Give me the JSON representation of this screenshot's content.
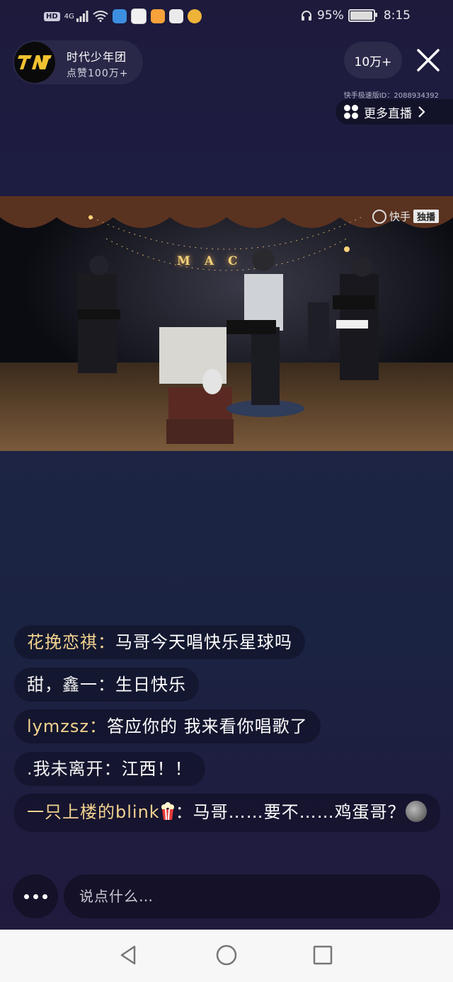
{
  "status_bar": {
    "left_chips": [
      "HD",
      "4G"
    ],
    "battery": "95%",
    "time": "8:15"
  },
  "host": {
    "name": "时代少年团",
    "likes": "点赞100万+"
  },
  "viewers": "10万+",
  "stream_id": "快手极速版ID：2088934392",
  "more_live_label": "更多直播",
  "video": {
    "badge_app": "快手",
    "badge_exclusive": "独播",
    "stage_letters": "MAC"
  },
  "comments": [
    {
      "user": "花挽恋祺：",
      "text": "马哥今天唱快乐星球吗",
      "user_color": "#f3d28f"
    },
    {
      "user": "甜，鑫一：",
      "text": "生日快乐",
      "user_color": "#f1f1f1"
    },
    {
      "user": "lymzsz：",
      "text": "答应你的 我来看你唱歌了",
      "user_color": "#f3d28f"
    },
    {
      "user": ".我未离开：",
      "text": "江西！！",
      "user_color": "#f1f1f1"
    },
    {
      "user": "一只上楼的blink",
      "text": "：马哥……要不……鸡蛋哥？",
      "user_color": "#f3d28f"
    }
  ],
  "input_placeholder": "说点什么…",
  "nav": {
    "icons": [
      "back-triangle-icon",
      "home-circle-icon",
      "recents-square-icon"
    ]
  }
}
